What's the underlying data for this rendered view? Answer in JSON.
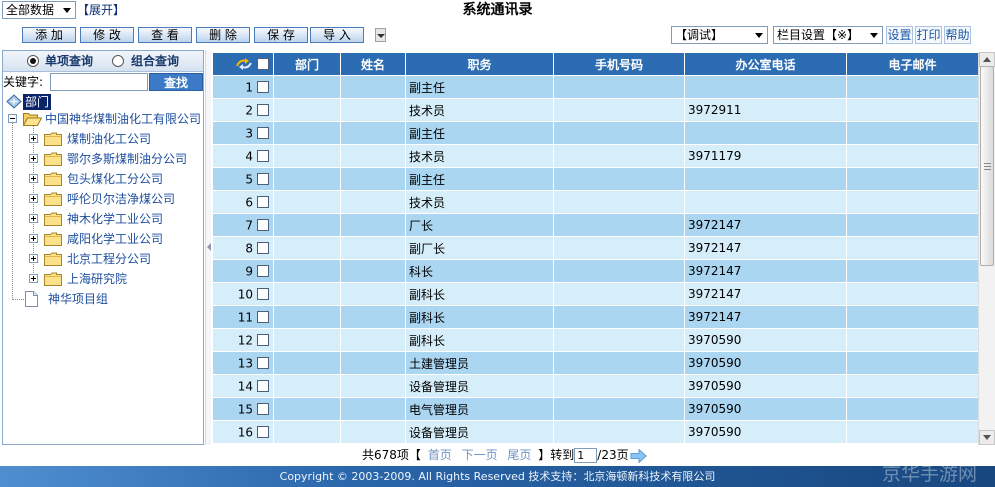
{
  "topbar": {
    "scope_select": "全部数据",
    "expand_link": "【展开】",
    "title": "系统通讯录"
  },
  "toolbar": {
    "buttons": [
      "添 加",
      "修 改",
      "查 看",
      "删 除",
      "保 存",
      "导 入"
    ],
    "debug_select": "【调试】",
    "column_select": "栏目设置【※】",
    "links": [
      "设置",
      "打印",
      "帮助"
    ]
  },
  "search": {
    "single_label": "单项查询",
    "combo_label": "组合查询",
    "single_selected": true,
    "keyword_label": "关键字:",
    "keyword_value": "",
    "find_button": "查找"
  },
  "tree": {
    "root": "部门",
    "company": "中国神华煤制油化工有限公司",
    "children": [
      "煤制油化工公司",
      "鄂尔多斯煤制油分公司",
      "包头煤化工分公司",
      "呼伦贝尔洁净煤公司",
      "神木化学工业公司",
      "咸阳化学工业公司",
      "北京工程分公司",
      "上海研究院"
    ],
    "project_group": "神华项目组"
  },
  "table": {
    "columns": [
      "部门",
      "姓名",
      "职务",
      "手机号码",
      "办公室电话",
      "电子邮件"
    ],
    "rows": [
      {
        "no": "1",
        "dept": "",
        "name": "",
        "title": "副主任",
        "mobile": "",
        "office": "",
        "email": ""
      },
      {
        "no": "2",
        "dept": "",
        "name": "",
        "title": "技术员",
        "mobile": "",
        "office": "3972911",
        "email": ""
      },
      {
        "no": "3",
        "dept": "",
        "name": "",
        "title": "副主任",
        "mobile": "",
        "office": "",
        "email": ""
      },
      {
        "no": "4",
        "dept": "",
        "name": "",
        "title": "技术员",
        "mobile": "",
        "office": "3971179",
        "email": ""
      },
      {
        "no": "5",
        "dept": "",
        "name": "",
        "title": "副主任",
        "mobile": "",
        "office": "",
        "email": ""
      },
      {
        "no": "6",
        "dept": "",
        "name": "",
        "title": "技术员",
        "mobile": "",
        "office": "",
        "email": ""
      },
      {
        "no": "7",
        "dept": "",
        "name": "",
        "title": "厂长",
        "mobile": "",
        "office": "3972147",
        "email": ""
      },
      {
        "no": "8",
        "dept": "",
        "name": "",
        "title": "副厂长",
        "mobile": "",
        "office": "3972147",
        "email": ""
      },
      {
        "no": "9",
        "dept": "",
        "name": "",
        "title": "科长",
        "mobile": "",
        "office": "3972147",
        "email": ""
      },
      {
        "no": "10",
        "dept": "",
        "name": "",
        "title": "副科长",
        "mobile": "",
        "office": "3972147",
        "email": ""
      },
      {
        "no": "11",
        "dept": "",
        "name": "",
        "title": "副科长",
        "mobile": "",
        "office": "3972147",
        "email": ""
      },
      {
        "no": "12",
        "dept": "",
        "name": "",
        "title": "副科长",
        "mobile": "",
        "office": "3970590",
        "email": ""
      },
      {
        "no": "13",
        "dept": "",
        "name": "",
        "title": "土建管理员",
        "mobile": "",
        "office": "3970590",
        "email": ""
      },
      {
        "no": "14",
        "dept": "",
        "name": "",
        "title": "设备管理员",
        "mobile": "",
        "office": "3970590",
        "email": ""
      },
      {
        "no": "15",
        "dept": "",
        "name": "",
        "title": "电气管理员",
        "mobile": "",
        "office": "3970590",
        "email": ""
      },
      {
        "no": "16",
        "dept": "",
        "name": "",
        "title": "设备管理员",
        "mobile": "",
        "office": "3970590",
        "email": ""
      }
    ]
  },
  "pagination": {
    "total": "共678项【",
    "first": "首页",
    "next": "下一页",
    "last": "尾页",
    "goto": "】转到",
    "page_value": "1",
    "page_total": "/23页"
  },
  "footer": {
    "copyright": "Copyright © 2003-2009. All Rights Reserved 技术支持：北京海顿新科技术有限公司"
  },
  "watermark": "京华手游网",
  "colors": {
    "header_bg": "#2c6cb2",
    "row_odd": "#abd6f1",
    "row_even": "#d6edfa",
    "tree_selected": "#0a246a",
    "find_button": "#3c79c6",
    "link": "#1e56a5"
  }
}
